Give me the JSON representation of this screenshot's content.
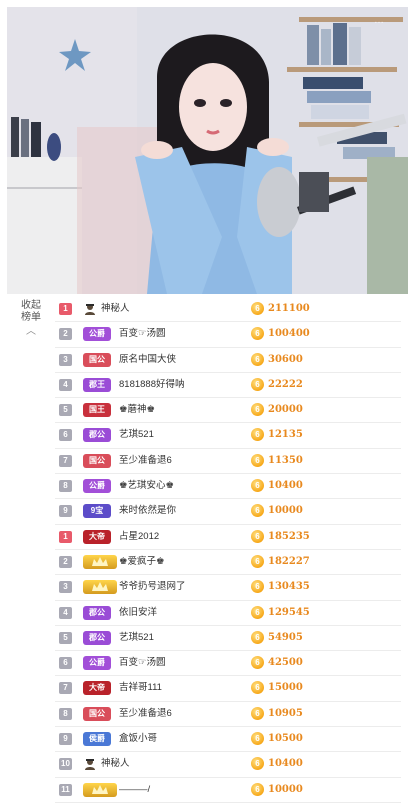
{
  "collapse": {
    "label_line1": "收起",
    "label_line2": "榜单",
    "icon": "chevron-up-icon"
  },
  "video": {
    "overlay_text": "…"
  },
  "colors": {
    "rank_top": "#e85a6a",
    "rank_normal": "#a9a9b4",
    "coin": "#f7a91b",
    "amount": "#e8891e",
    "badge_gongjue": "#a24fd8",
    "badge_guogong": "#d94d5a",
    "badge_dushang": "#9a4cd6",
    "badge_guowang": "#c8303c",
    "badge_wang": "#5c4cc9",
    "badge_dadi": "#b9222a",
    "badge_gold": "#d49b1e",
    "badge_houjue": "#4a78d6"
  },
  "leaderboard": [
    {
      "rank": "1",
      "tier": "top",
      "badge": "",
      "badge_type": "mystery",
      "name": "神秘人",
      "amount": "211100"
    },
    {
      "rank": "2",
      "tier": "normal",
      "badge": "公爵",
      "badge_type": "gongjue",
      "name": "百变☞汤圆",
      "amount": "100400"
    },
    {
      "rank": "3",
      "tier": "normal",
      "badge": "国公",
      "badge_type": "guogong",
      "name": "原名中国大侠",
      "amount": "30600"
    },
    {
      "rank": "4",
      "tier": "normal",
      "badge": "郡王",
      "badge_type": "dushang",
      "name": "8181888好得呐",
      "amount": "22222"
    },
    {
      "rank": "5",
      "tier": "normal",
      "badge": "国王",
      "badge_type": "guowang",
      "name": "♚蘑神♚",
      "amount": "20000"
    },
    {
      "rank": "6",
      "tier": "normal",
      "badge": "郡公",
      "badge_type": "dushang",
      "name": "艺琪521",
      "amount": "12135"
    },
    {
      "rank": "7",
      "tier": "normal",
      "badge": "国公",
      "badge_type": "guogong",
      "name": "至少准备退6",
      "amount": "11350"
    },
    {
      "rank": "8",
      "tier": "normal",
      "badge": "公爵",
      "badge_type": "gongjue",
      "name": "♚艺琪安心♚",
      "amount": "10400"
    },
    {
      "rank": "9",
      "tier": "normal",
      "badge": "9宝",
      "badge_type": "wang",
      "name": "来时依然是你",
      "amount": "10000"
    },
    {
      "rank": "1",
      "tier": "top",
      "badge": "大帝",
      "badge_type": "dadi",
      "name": "占星2012",
      "amount": "185235"
    },
    {
      "rank": "2",
      "tier": "normal",
      "badge": "",
      "badge_type": "gold",
      "name": "♚爱疯子♚",
      "amount": "182227"
    },
    {
      "rank": "3",
      "tier": "normal",
      "badge": "",
      "badge_type": "gold",
      "name": "爷爷扔号退网了",
      "amount": "130435"
    },
    {
      "rank": "4",
      "tier": "normal",
      "badge": "郡公",
      "badge_type": "dushang",
      "name": "依旧安洋",
      "amount": "129545"
    },
    {
      "rank": "5",
      "tier": "normal",
      "badge": "郡公",
      "badge_type": "dushang",
      "name": "艺琪521",
      "amount": "54905"
    },
    {
      "rank": "6",
      "tier": "normal",
      "badge": "公爵",
      "badge_type": "gongjue",
      "name": "百变☞汤圆",
      "amount": "42500"
    },
    {
      "rank": "7",
      "tier": "normal",
      "badge": "大帝",
      "badge_type": "dadi",
      "name": "吉祥哥111",
      "amount": "15000"
    },
    {
      "rank": "8",
      "tier": "normal",
      "badge": "国公",
      "badge_type": "guogong",
      "name": "至少准备退6",
      "amount": "10905"
    },
    {
      "rank": "9",
      "tier": "normal",
      "badge": "侯爵",
      "badge_type": "houjue",
      "name": "盒饭小哥",
      "amount": "10500"
    },
    {
      "rank": "10",
      "tier": "normal",
      "badge": "",
      "badge_type": "mystery",
      "name": "神秘人",
      "amount": "10400"
    },
    {
      "rank": "11",
      "tier": "normal",
      "badge": "",
      "badge_type": "gold",
      "name": "———/",
      "amount": "10000"
    }
  ]
}
